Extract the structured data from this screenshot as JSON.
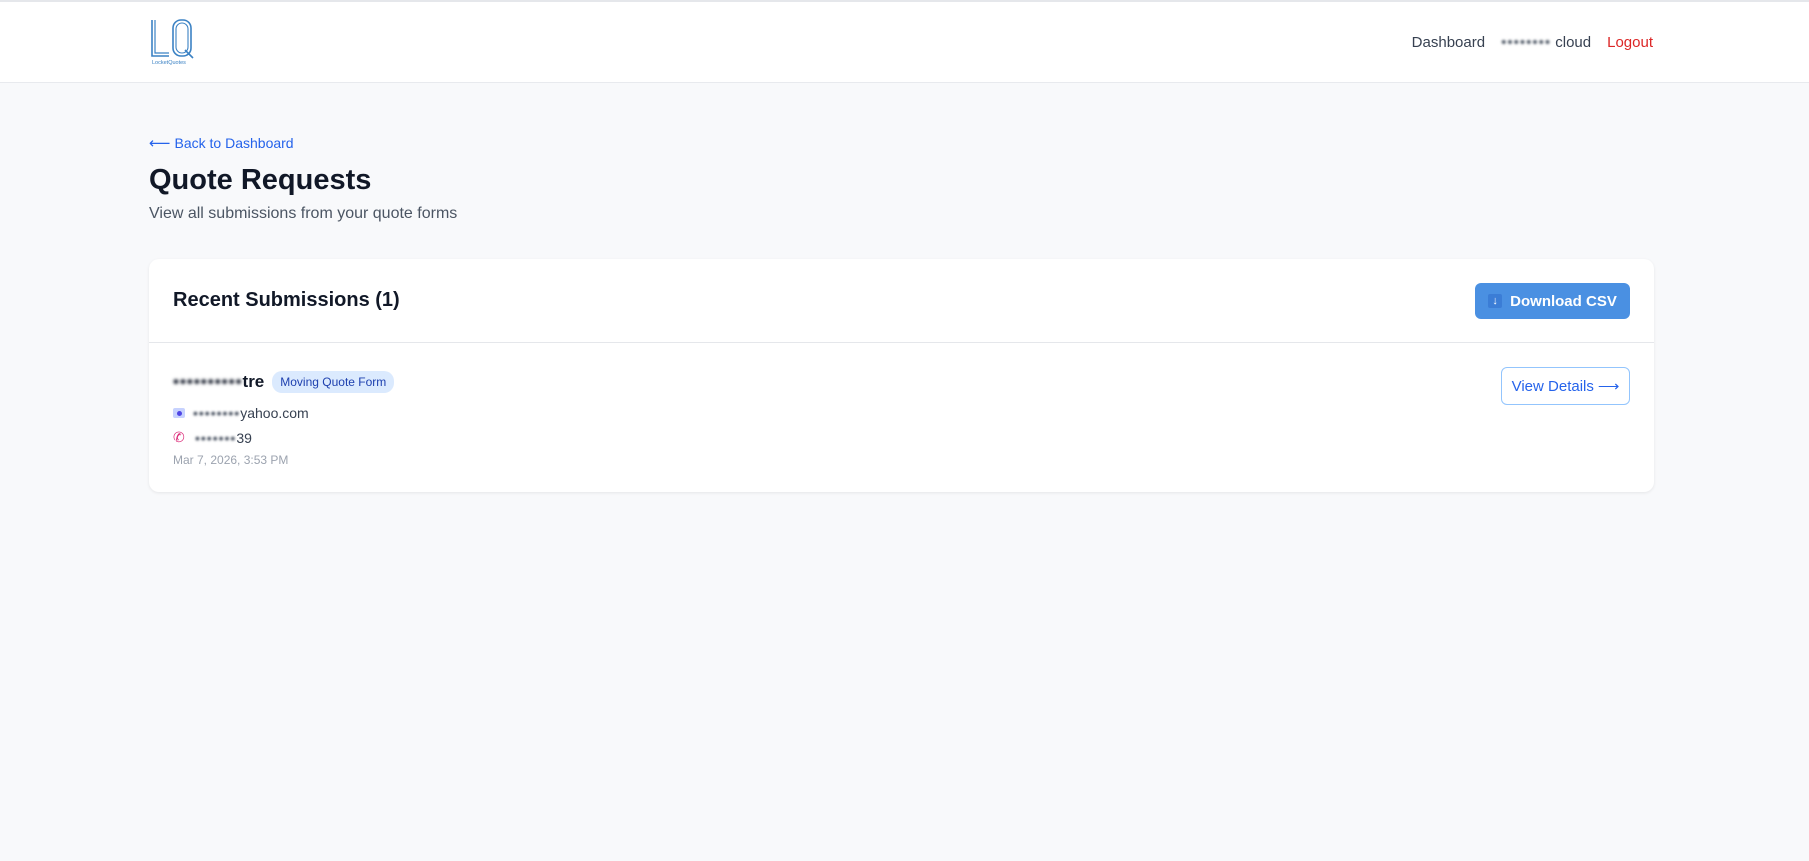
{
  "header": {
    "logo_text": "LQ",
    "logo_caption": "LocketQuotes",
    "nav": {
      "dashboard": "Dashboard",
      "user_hidden": "••••••••",
      "user_suffix": "cloud",
      "logout": "Logout"
    }
  },
  "page": {
    "back_link": "Back to Dashboard",
    "back_arrow": "⟵",
    "title": "Quote Requests",
    "subtitle": "View all submissions from your quote forms"
  },
  "submissions": {
    "title": "Recent Submissions (1)",
    "download_label": "Download CSV",
    "download_icon": "↓",
    "items": [
      {
        "name_hidden": "••••••••••",
        "name_visible": "tre",
        "form_badge": "Moving Quote Form",
        "email_hidden": "••••••••",
        "email_visible": "yahoo.com",
        "phone_hidden": "•••••••",
        "phone_visible": "39",
        "date": "Mar 7, 2026, 3:53 PM",
        "details_label": "View Details",
        "details_arrow": "⟶"
      }
    ]
  },
  "colors": {
    "accent": "#2563eb",
    "button_primary": "#4a90e2",
    "logout": "#dc2626",
    "badge_bg": "#dbeafe"
  }
}
